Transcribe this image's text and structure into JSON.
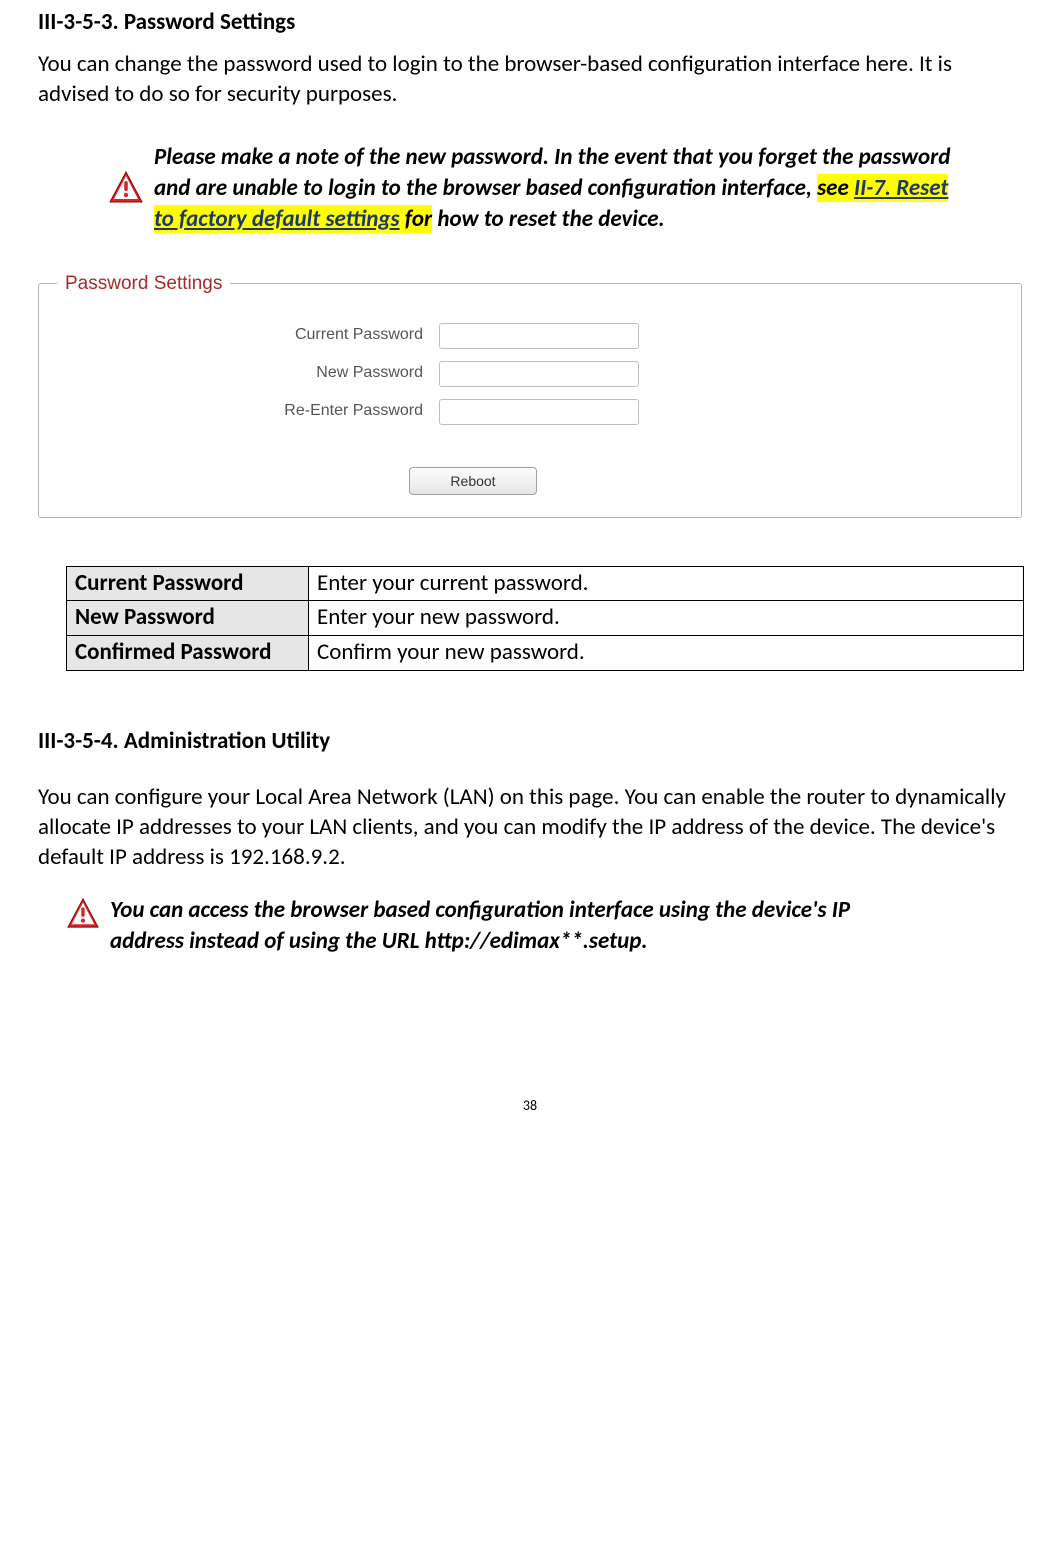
{
  "section1": {
    "title": "III-3-5-3.    Password Settings",
    "intro": "You can change the password used to login to the browser-based configuration interface here. It is advised to do so for security purposes.",
    "note": {
      "pre": "Please make a note of the new password. In the event that you forget the password and are unable to login to the browser based configuration interface, ",
      "see": "see ",
      "link": "II-7. Reset to factory default settings",
      "for": " for",
      "post": " how to reset the device."
    },
    "screenshot": {
      "legend": "Password Settings",
      "labels": {
        "current": "Current Password",
        "new": "New Password",
        "reenter": "Re-Enter Password"
      },
      "button": "Reboot"
    },
    "table": [
      {
        "key": "Current Password",
        "desc": "Enter your current password."
      },
      {
        "key": "New Password",
        "desc": "Enter your new password."
      },
      {
        "key": "Confirmed Password",
        "desc": "Confirm your new password."
      }
    ]
  },
  "section2": {
    "title": "III-3-5-4.    Administration Utility",
    "body": "You can configure your Local Area Network (LAN) on this page. You can enable the router to dynamically allocate IP addresses to your LAN clients, and you can modify the IP address of the device. The device's default IP address is 192.168.9.2.",
    "note": "You can access the browser based configuration interface using the device's IP address instead of using the URL http://edimax**.setup."
  },
  "page_number": "38"
}
